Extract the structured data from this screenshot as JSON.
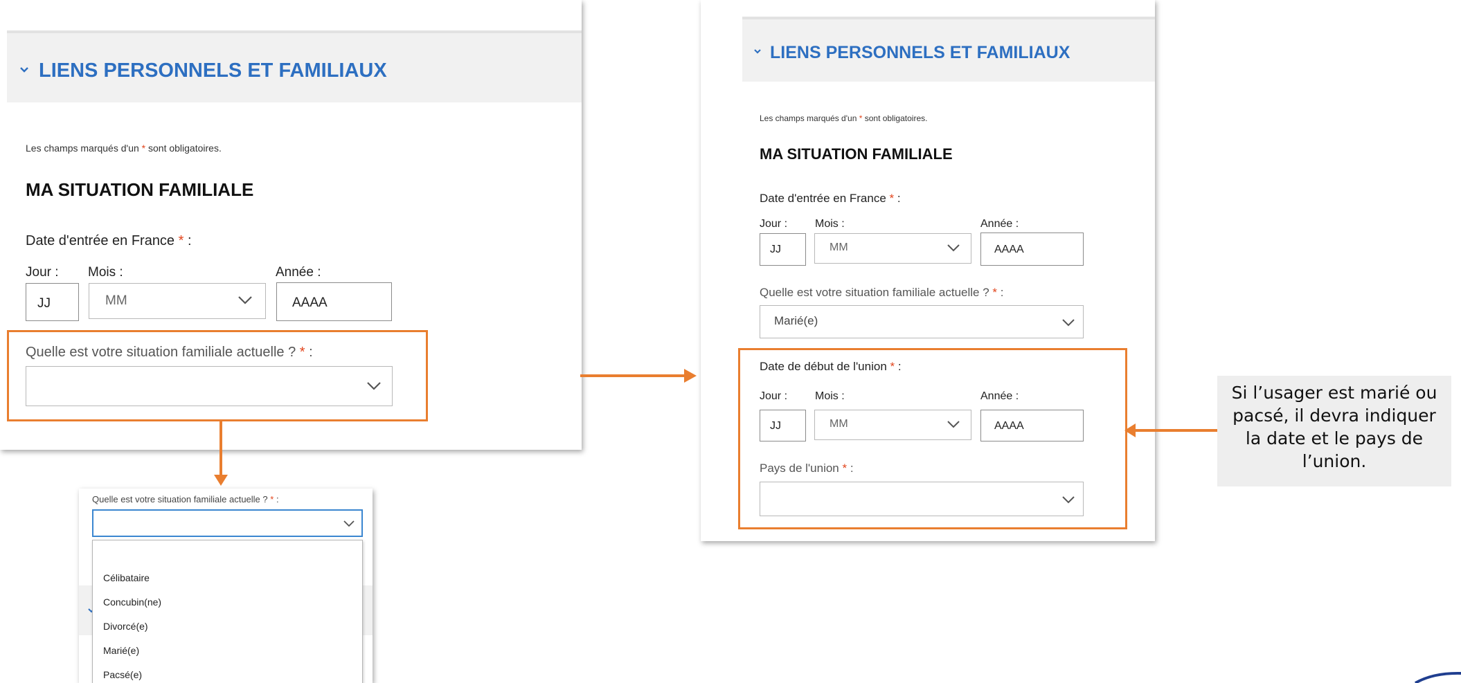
{
  "section_title": "LIENS PERSONNELS ET FAMILIAUX",
  "required_note_prefix": "Les champs marqués d'un",
  "required_note_star": "*",
  "required_note_suffix": "sont obligatoires.",
  "subsection_title": "MA SITUATION FAMILIALE",
  "date_entree_label": "Date d'entrée en France",
  "req_star": "*",
  "colon": " :",
  "jour_label": "Jour :",
  "mois_label": "Mois :",
  "annee_label": "Année :",
  "jour_placeholder": "JJ",
  "mois_placeholder": "MM",
  "annee_placeholder": "AAAA",
  "situation_label": "Quelle est votre situation familiale actuelle ?",
  "left_panel": {
    "situation_value": ""
  },
  "dropdown": {
    "label": "Quelle est votre situation familiale actuelle ?",
    "value": "",
    "options": [
      "",
      "Célibataire",
      "Concubin(ne)",
      "Divorcé(e)",
      "Marié(e)",
      "Pacsé(e)"
    ]
  },
  "right_panel": {
    "situation_value": "Marié(e)",
    "union_date_label": "Date de début de l'union",
    "union_country_label": "Pays de l'union",
    "union_country_value": ""
  },
  "callout_text": "Si l’usager est marié ou pacsé, il devra indiquer la date et le pays de l’union.",
  "colors": {
    "accent_blue": "#2d6fc1",
    "orange": "#e97e2f",
    "required_red": "#e2451d"
  }
}
